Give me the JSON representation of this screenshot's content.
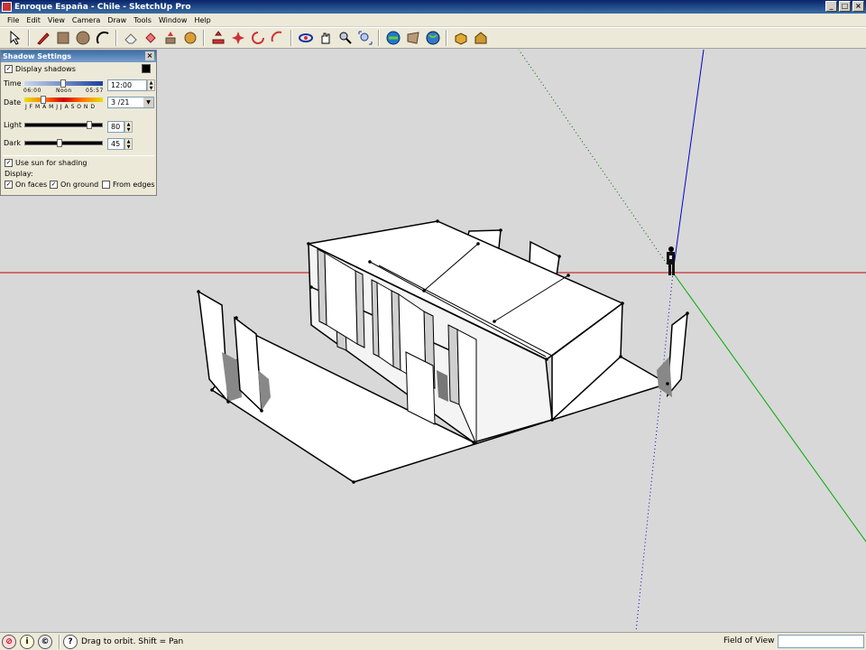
{
  "window": {
    "title": "Enroque España - Chile - SketchUp Pro"
  },
  "menu": [
    "File",
    "Edit",
    "View",
    "Camera",
    "Draw",
    "Tools",
    "Window",
    "Help"
  ],
  "toolbar": {
    "tools": [
      "select-icon",
      "pencil-icon",
      "rectangle-icon",
      "circle-icon",
      "arc-icon",
      "eraser-icon",
      "paint-bucket-icon",
      "push-pull-icon",
      "follow-me-icon",
      "move-icon",
      "rotate-icon",
      "offset-icon",
      "scale-icon",
      "orbit-icon",
      "pan-icon",
      "zoom-icon",
      "zoom-extents-icon",
      "get-models-icon",
      "share-model-icon",
      "google-earth-icon",
      "components-icon",
      "warehouse-icon"
    ]
  },
  "shadow_panel": {
    "title": "Shadow Settings",
    "display_shadows_label": "Display shadows",
    "display_shadows_checked": true,
    "time_label": "Time",
    "time_start": "06:00",
    "time_mid": "Noon",
    "time_end": "05:57",
    "time_value": "12:00",
    "date_label": "Date",
    "date_months": "J F M A M J J A S O N D",
    "date_value": "3 /21",
    "light_label": "Light",
    "light_value": "80",
    "dark_label": "Dark",
    "dark_value": "45",
    "use_sun_label": "Use sun for shading",
    "use_sun_checked": true,
    "display_label": "Display:",
    "on_faces_label": "On faces",
    "on_faces_checked": true,
    "on_ground_label": "On ground",
    "on_ground_checked": true,
    "from_edges_label": "From edges",
    "from_edges_checked": false
  },
  "statusbar": {
    "hint": "Drag to orbit.  Shift = Pan",
    "measurement_label": "Field of View"
  },
  "colors": {
    "axis_red": "#cc0000",
    "axis_green": "#00aa00",
    "axis_blue": "#0000cc",
    "background": "#d8d8d8"
  }
}
